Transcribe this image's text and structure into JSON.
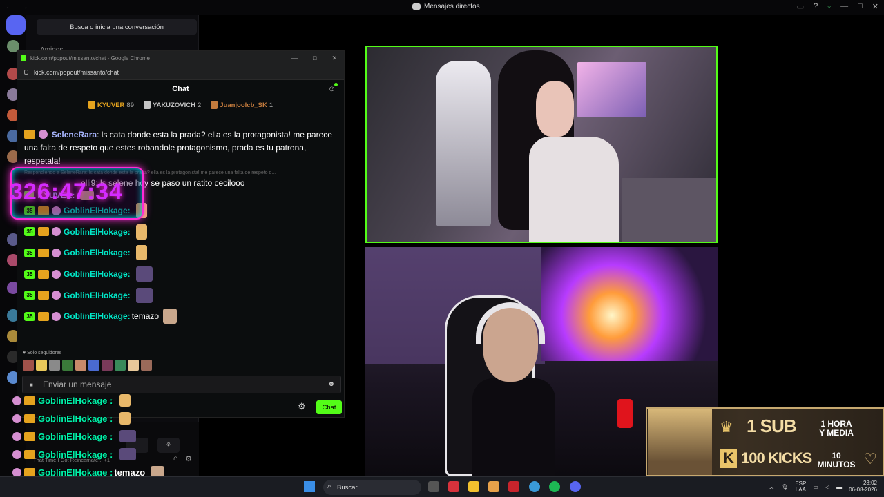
{
  "discord": {
    "window_title": "Mensajes directos",
    "search_label": "Busca o inicia una conversación",
    "friends_label": "Amigos",
    "status_line": "That Time I Got Reincarnate... +1"
  },
  "kick": {
    "window_title": "kick.com/popout/missanto/chat - Google Chrome",
    "url": "kick.com/popout/missanto/chat",
    "chat_title": "Chat",
    "leaderboard": [
      {
        "name": "KYUVER",
        "count": "89",
        "color": "#e5a31e"
      },
      {
        "name": "YAKUZOVICH",
        "count": "2",
        "color": "#c5c5c5"
      },
      {
        "name": "Juanjoolcb_SK",
        "count": "1",
        "color": "#c47b3d"
      }
    ],
    "message1_user": "SeleneRara",
    "message1_text": ": ls cata donde esta la prada? ella es la protagonista! me parece una falta de respeto que estes robandole protagonismo, prada es tu patrona, respetala!",
    "reply_preview": "Respondiendo a SeleneRara: ls cata donde esta la prada? ella es la protagonista! me parece una falta de respeto q...",
    "message2_text": "elli9: ls selene hoy se paso un ratito cecilooo",
    "message3_user": "KYUVER:",
    "goblin_rows": [
      {
        "badge": "35",
        "user": "GoblinElHokage:",
        "text": ""
      },
      {
        "badge": "35",
        "user": "GoblinElHokage:",
        "text": ""
      },
      {
        "badge": "35",
        "user": "GoblinElHokage:",
        "text": ""
      },
      {
        "badge": "35",
        "user": "GoblinElHokage:",
        "text": ""
      },
      {
        "badge": "35",
        "user": "GoblinElHokage:",
        "text": ""
      },
      {
        "badge": "35",
        "user": "GoblinElHokage:",
        "text": "temazo"
      }
    ],
    "followers_only": "Solo seguidores",
    "input_placeholder": "Enviar un mensaje",
    "send_label": "Chat"
  },
  "overlay": {
    "counter": "326:47:34",
    "chat_rows": [
      {
        "user": "GoblinElHokage :",
        "text": ""
      },
      {
        "user": "GoblinElHokage :",
        "text": ""
      },
      {
        "user": "GoblinElHokage :",
        "text": ""
      },
      {
        "user": "GoblinElHokage :",
        "text": ""
      },
      {
        "user": "GoblinElHokage :",
        "text": "temazo"
      }
    ]
  },
  "banner": {
    "sub_text": "1 SUB",
    "sub_reward_line1": "1 HORA",
    "sub_reward_line2": "Y MEDIA",
    "kicks_letter": "K",
    "kicks_text": "100 KICKS",
    "kicks_reward_line1": "10",
    "kicks_reward_line2": "MINUTOS"
  },
  "taskbar": {
    "search_label": "Buscar",
    "lang_line1": "ESP",
    "lang_line2": "LAA",
    "time": "23:02",
    "date": "06-08-2026"
  },
  "colors": {
    "kick_green": "#53fc18",
    "discord_blurple": "#5865f2",
    "username_teal": "#00e8c8",
    "counter_pink": "#d42bff"
  }
}
